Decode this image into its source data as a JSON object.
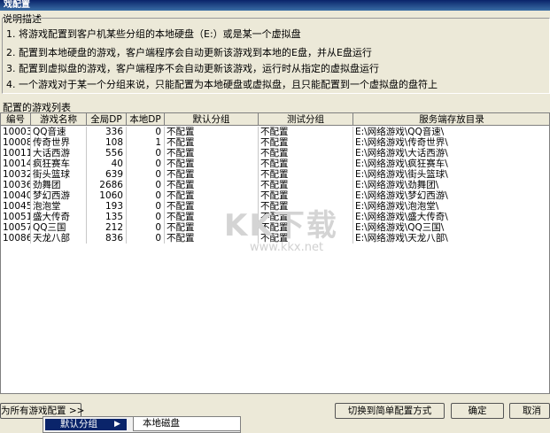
{
  "window": {
    "title": "戏配置"
  },
  "description": {
    "label": "说明描述",
    "lines": [
      "1. 将游戏配置到客户机某些分组的本地硬盘（E:）或是某一个虚拟盘",
      "2. 配置到本地硬盘的游戏，客户端程序会自动更新该游戏到本地的E盘，并从E盘运行",
      "3. 配置到虚拟盘的游戏，客户端程序不会自动更新该游戏，运行时从指定的虚拟盘运行",
      "4. 一个游戏对于某一个分组来说，只能配置为本地硬盘或虚拟盘，且只能配置到一个虚拟盘的盘符上"
    ]
  },
  "list": {
    "label": "配置的游戏列表",
    "columns": [
      "编号",
      "游戏名称",
      "全局DP",
      "本地DP",
      "默认分组",
      "测试分组",
      "服务端存放目录"
    ],
    "rows": [
      [
        "10003",
        "QQ音速",
        "336",
        "0",
        "不配置",
        "不配置",
        "E:\\网络游戏\\QQ音速\\"
      ],
      [
        "10008",
        "传奇世界",
        "108",
        "1",
        "不配置",
        "不配置",
        "E:\\网络游戏\\传奇世界\\"
      ],
      [
        "10011",
        "大话西游",
        "556",
        "0",
        "不配置",
        "不配置",
        "E:\\网络游戏\\大话西游\\"
      ],
      [
        "10014",
        "疯狂赛车",
        "40",
        "0",
        "不配置",
        "不配置",
        "E:\\网络游戏\\疯狂赛车\\"
      ],
      [
        "10032",
        "街头篮球",
        "639",
        "0",
        "不配置",
        "不配置",
        "E:\\网络游戏\\街头篮球\\"
      ],
      [
        "10036",
        "劲舞团",
        "2686",
        "0",
        "不配置",
        "不配置",
        "E:\\网络游戏\\劲舞团\\"
      ],
      [
        "10040",
        "梦幻西游",
        "1060",
        "0",
        "不配置",
        "不配置",
        "E:\\网络游戏\\梦幻西游\\"
      ],
      [
        "10045",
        "泡泡堂",
        "193",
        "0",
        "不配置",
        "不配置",
        "E:\\网络游戏\\泡泡堂\\"
      ],
      [
        "10051",
        "盛大传奇",
        "135",
        "0",
        "不配置",
        "不配置",
        "E:\\网络游戏\\盛大传奇\\"
      ],
      [
        "10057",
        "QQ三国",
        "212",
        "0",
        "不配置",
        "不配置",
        "E:\\网络游戏\\QQ三国\\"
      ],
      [
        "10086",
        "天龙八部",
        "836",
        "0",
        "不配置",
        "不配置",
        "E:\\网络游戏\\天龙八部\\"
      ]
    ]
  },
  "watermark": {
    "text": "KK下载",
    "url": "www.kkx.net"
  },
  "footer": {
    "configure_button": "为所有游戏配置 >>",
    "switch_button": "切换到简单配置方式",
    "ok_button": "确定",
    "cancel_button": "取消"
  },
  "context_menu": {
    "item": "默认分组",
    "submenu_item": "本地磁盘"
  }
}
